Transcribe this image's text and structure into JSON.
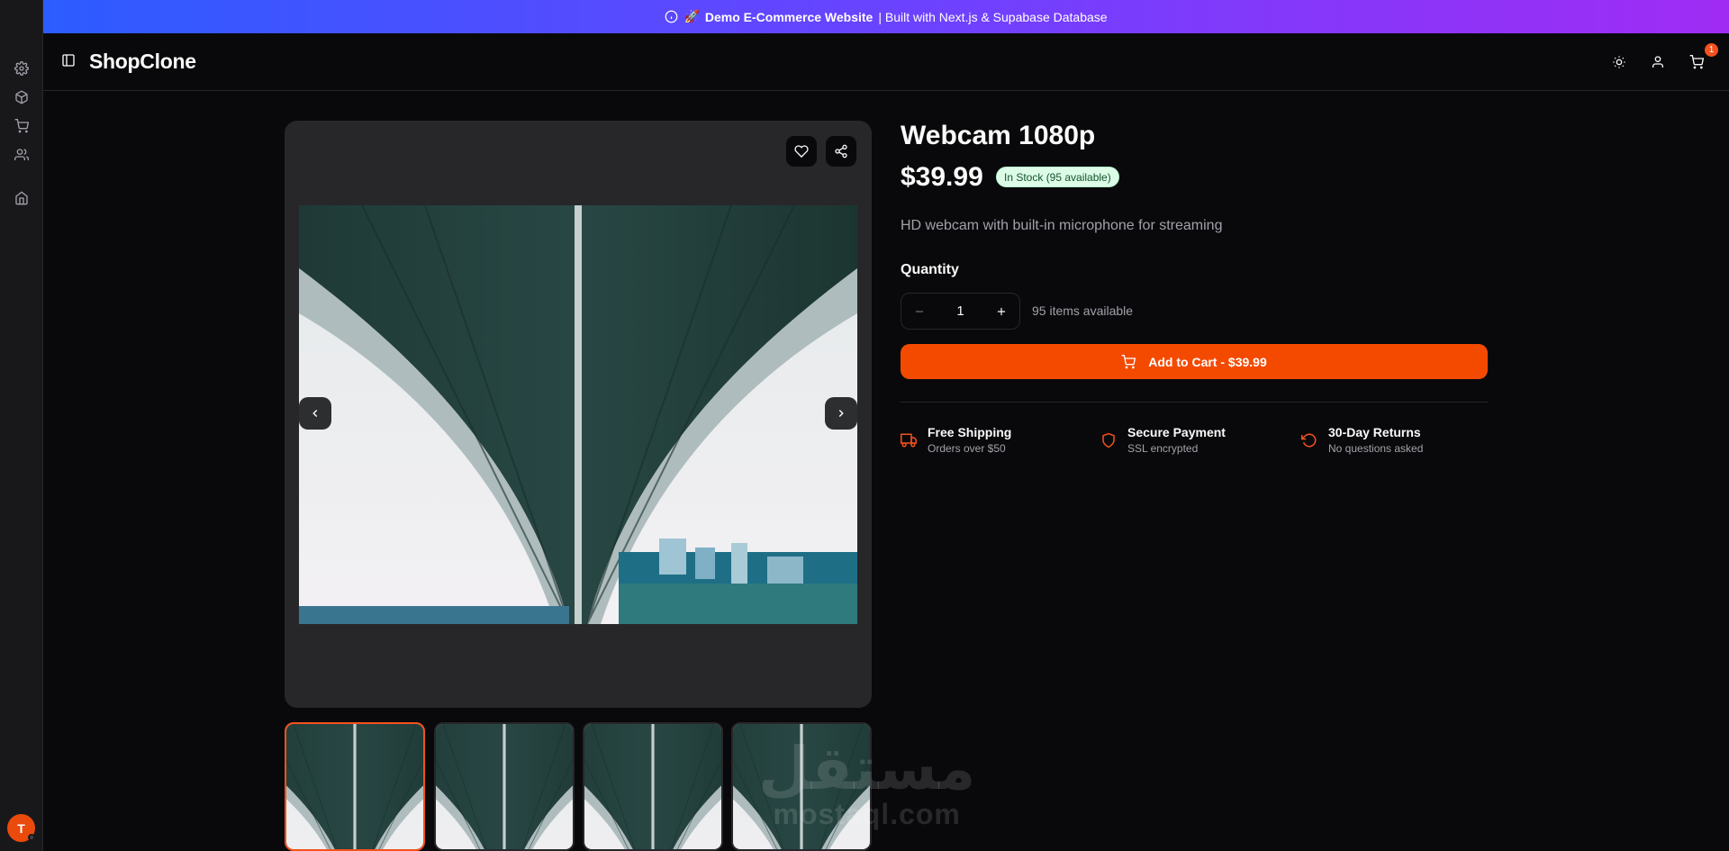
{
  "banner": {
    "emoji": "🚀",
    "highlight": "Demo E-Commerce Website",
    "text": "| Built with Next.js & Supabase Database"
  },
  "header": {
    "brand": "ShopClone",
    "cart_count": "1"
  },
  "sidebar": {
    "items": [
      "settings",
      "products",
      "cart",
      "users",
      "home"
    ],
    "avatar_initial": "T"
  },
  "product": {
    "title": "Webcam 1080p",
    "price": "$39.99",
    "stock_badge": "In Stock (95 available)",
    "description": "HD webcam with built-in microphone for streaming",
    "quantity_label": "Quantity",
    "quantity_value": "1",
    "available_text": "95 items available",
    "add_to_cart_label": "Add to Cart - $39.99"
  },
  "features": [
    {
      "title": "Free Shipping",
      "subtitle": "Orders over $50",
      "icon": "truck-icon"
    },
    {
      "title": "Secure Payment",
      "subtitle": "SSL encrypted",
      "icon": "shield-icon"
    },
    {
      "title": "30-Day Returns",
      "subtitle": "No questions asked",
      "icon": "rotate-ccw-icon"
    }
  ],
  "watermark": {
    "arabic": "مستقل",
    "latin": "mostaql.com"
  },
  "colors": {
    "accent": "#f44a00",
    "background": "#09090b",
    "panel": "#27272a"
  }
}
